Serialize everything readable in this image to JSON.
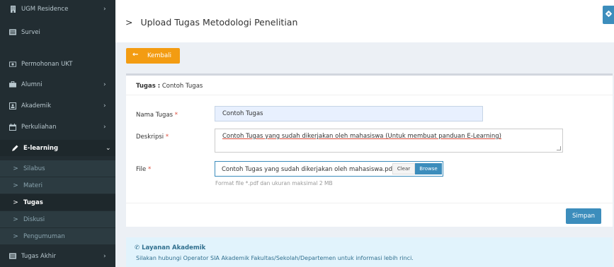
{
  "sidebar": {
    "items": [
      {
        "label": "UGM Residence",
        "icon": "building-icon",
        "chevron": "›"
      },
      {
        "label": "Survei",
        "icon": "list-icon",
        "chevron": ""
      },
      {
        "label": "Permohonan UKT",
        "icon": "money-icon",
        "chevron": ""
      },
      {
        "label": "Alumni",
        "icon": "briefcase-icon",
        "chevron": "›"
      },
      {
        "label": "Akademik",
        "icon": "user-card-icon",
        "chevron": "›"
      },
      {
        "label": "Perkuliahan",
        "icon": "calendar-icon",
        "chevron": "›"
      },
      {
        "label": "E-learning",
        "icon": "pencil-icon",
        "chevron": "⌄"
      },
      {
        "label": "Silabus",
        "icon": "chevron-right-icon",
        "chevron": ""
      },
      {
        "label": "Materi",
        "icon": "chevron-right-icon",
        "chevron": ""
      },
      {
        "label": "Tugas",
        "icon": "chevron-right-icon",
        "chevron": ""
      },
      {
        "label": "Diskusi",
        "icon": "chevron-right-icon",
        "chevron": ""
      },
      {
        "label": "Pengumuman",
        "icon": "chevron-right-icon",
        "chevron": ""
      },
      {
        "label": "Tugas Akhir",
        "icon": "list-icon",
        "chevron": "›"
      }
    ],
    "sub_prefix": ">"
  },
  "header": {
    "breadcrumb_sep": ">",
    "title": "Upload Tugas Metodologi Penelitian"
  },
  "back_button": {
    "arrow": "←",
    "label": "Kembali"
  },
  "form": {
    "heading_label": "Tugas :",
    "heading_value": "Contoh Tugas",
    "nama_label": "Nama Tugas",
    "nama_value": "Contoh Tugas",
    "deskripsi_label": "Deskripsi",
    "deskripsi_value": "Contoh Tugas yang sudah dikerjakan oleh mahasiswa (Untuk membuat panduan E-Learning)",
    "file_label": "File",
    "file_value": "Contoh Tugas yang sudah dikerjakan oleh mahasiswa.pdf",
    "clear_label": "Clear",
    "browse_label": "Browse",
    "file_help": "Format file *.pdf dan ukuran maksimal 2 MB",
    "required_mark": "*",
    "save_label": "Simpan"
  },
  "info": {
    "phone_glyph": "✆",
    "title": "Layanan Akademik",
    "text": "Silakan hubungi Operator SIA Akademik Fakultas/Sekolah/Departemen untuk informasi lebih rinci."
  },
  "colors": {
    "sidebar_bg": "#222d32",
    "primary": "#3c8dbc",
    "warning": "#f39c12",
    "required": "#dd4b39"
  }
}
